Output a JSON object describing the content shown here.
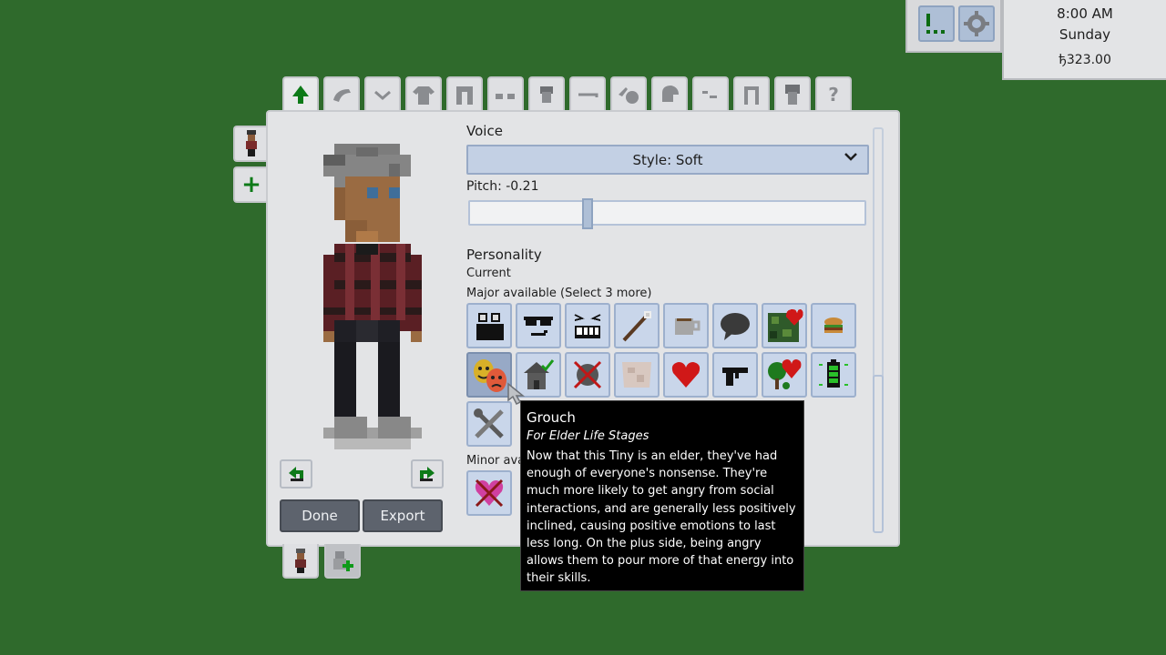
{
  "hud": {
    "time": "8:00 AM",
    "day": "Sunday",
    "money": "ђ323.00",
    "buttons": [
      "alerts-icon",
      "settings-gear-icon"
    ]
  },
  "top_tabs": [
    "tree-icon",
    "hair-icon",
    "eyebrow-icon",
    "shirt-icon",
    "pants-icon",
    "shoes-icon",
    "head-icon",
    "mouth-icon",
    "hat-icon",
    "helmet-icon",
    "accessory-icon",
    "outfit-icon",
    "character-icon",
    "help-icon"
  ],
  "voice": {
    "heading": "Voice",
    "style": "Style: Soft",
    "pitch_label": "Pitch: -0.21",
    "pitch_value": -0.21
  },
  "personality": {
    "heading": "Personality",
    "current_label": "Current",
    "major_label": "Major available (Select 3 more)",
    "minor_label": "Minor available",
    "minor_label_visible": "Minor ava"
  },
  "traits_row1": [
    "film-clapper-icon",
    "sunglasses-icon",
    "grin-icon",
    "magic-wand-icon",
    "coffee-cup-icon",
    "speech-bubble-icon",
    "camo-heart-icon",
    "burger-icon"
  ],
  "traits_row2": [
    "theater-masks-icon",
    "house-check-icon",
    "crossed-out-icon",
    "map-icon",
    "heart-icon",
    "gun-icon",
    "tree-heart-icon",
    "battery-icon"
  ],
  "traits_row3": [
    "tools-icon"
  ],
  "minor_traits": [
    "crossed-heart-icon"
  ],
  "buttons": {
    "done": "Done",
    "export": "Export"
  },
  "tooltip": {
    "title": "Grouch",
    "subtitle": "For Elder Life Stages",
    "body": "Now that this Tiny is an elder, they've had enough of everyone's nonsense. They're much more likely to get angry from social interactions, and are generally less positively inclined, causing positive emotions to last less long. On the plus side, being angry allows them to pour more of that energy into their skills."
  },
  "colors": {
    "background": "#2f6a2c",
    "panel": "#e3e4e6",
    "trait_tile": "#c9d6ea",
    "button_dark": "#5d636d",
    "tooltip_bg": "#000000"
  }
}
